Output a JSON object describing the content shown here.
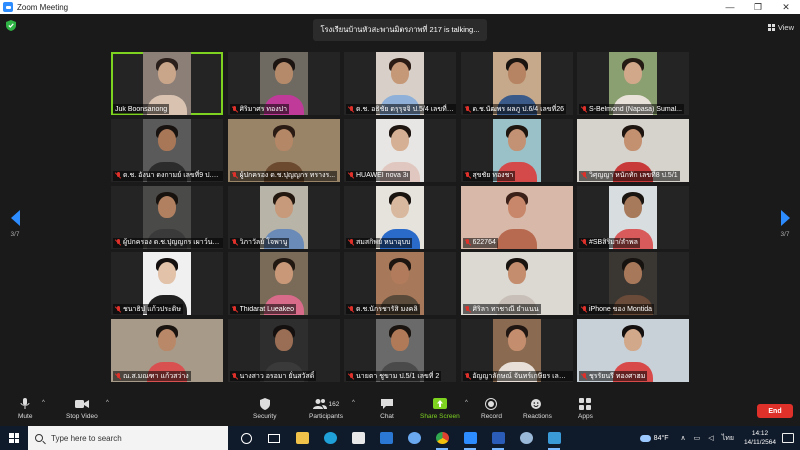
{
  "window": {
    "title": "Zoom Meeting",
    "controls": [
      "—",
      "❐",
      "✕"
    ]
  },
  "meeting": {
    "talking_banner": "โรงเรียนบ้านหัวสะพานมิตรภาพที่ 217 is talking...",
    "view_label": "View",
    "page_indicator": "3/7"
  },
  "participants": [
    {
      "name": "Juk Boonsanong",
      "muted": false,
      "skin": "#c9a58a",
      "hair": "#2a1f1a",
      "body": "#d9c2b0",
      "bg": "#8b7f78",
      "wide": false
    },
    {
      "name": "ศิริมาศร ทองปา",
      "muted": true,
      "skin": "#b58a6a",
      "hair": "#1c1410",
      "body": "#c03a9a",
      "bg": "#6e6a62",
      "wide": false
    },
    {
      "name": "ด.ช. อธิชัย ดรุรุจจิ ป.5/4 เลขที่15",
      "muted": true,
      "skin": "#c59878",
      "hair": "#2a1c14",
      "body": "#8fb0d8",
      "bg": "#d8d0c8",
      "wide": false
    },
    {
      "name": "ด.ช.นัฒพร ผลภู ป.6/4 เลขที่26",
      "muted": true,
      "skin": "#b78463",
      "hair": "#1a1410",
      "body": "#3a5a8a",
      "bg": "#c6a98a",
      "wide": false
    },
    {
      "name": "S-Belmond (Napasa) Sumal...",
      "muted": true,
      "skin": "#d1a88a",
      "hair": "#241a14",
      "body": "#e8e2da",
      "bg": "#8aa070",
      "wide": false
    },
    {
      "name": "ด.ช. อังนา ดงกามย์ เลขที่9 ป.6/1",
      "muted": true,
      "skin": "#a87758",
      "hair": "#181210",
      "body": "#2c2c2c",
      "bg": "#5a5a5a",
      "wide": false
    },
    {
      "name": "ผู้ปกครอง ด.ช.ปุญญกร ทรางร...",
      "muted": true,
      "skin": "#b48767",
      "hair": "#2a1c14",
      "body": "#6b4a30",
      "bg": "#9a8468",
      "wide": true
    },
    {
      "name": "HUAWEI nova 3i",
      "muted": true,
      "skin": "#d6b094",
      "hair": "#1e1510",
      "body": "#e0c8c0",
      "bg": "#e8e6e4",
      "wide": false
    },
    {
      "name": "สุขชัย ทองชา",
      "muted": true,
      "skin": "#c39274",
      "hair": "#201610",
      "body": "#d44a4a",
      "bg": "#9ac0c8",
      "wide": false
    },
    {
      "name": "วิศุญญา หนักทัก เลขที่8 ป.5/1",
      "muted": true,
      "skin": "#c39070",
      "hair": "#1e1510",
      "body": "#c83a3a",
      "bg": "#d6d2cc",
      "wide": true
    },
    {
      "name": "ผู้ปกครอง ด.ช.ปุญญกร เผาว์นาน",
      "muted": true,
      "skin": "#b08060",
      "hair": "#18120e",
      "body": "#3a3a3a",
      "bg": "#4a4a48",
      "wide": false
    },
    {
      "name": "วิภาวัลย์ โจพานู",
      "muted": true,
      "skin": "#c69a7a",
      "hair": "#221810",
      "body": "#6a8ab8",
      "bg": "#b8b4a8",
      "wide": false
    },
    {
      "name": "สมสกิพย์ หนาอุบบ",
      "muted": true,
      "skin": "#d8b89e",
      "hair": "#1a1410",
      "body": "#2a6ac8",
      "bg": "#e6e2dc",
      "wide": false
    },
    {
      "name": "622764",
      "muted": true,
      "skin": "#c8876a",
      "hair": "#3a2018",
      "body": "#b86a50",
      "bg": "#d8b8a8",
      "wide": true
    },
    {
      "name": "#SBสิริมา/ลำพล",
      "muted": true,
      "skin": "#a87a5c",
      "hair": "#1a1410",
      "body": "#d85a5a",
      "bg": "#d8dee0",
      "wide": false
    },
    {
      "name": "ชนาธิป แก้วประดิษ",
      "muted": true,
      "skin": "#e2c2a8",
      "hair": "#141010",
      "body": "#202020",
      "bg": "#f0f0f0",
      "wide": false
    },
    {
      "name": "Thidarat Lueakeo",
      "muted": true,
      "skin": "#c89878",
      "hair": "#221812",
      "body": "#d86a8a",
      "bg": "#7a6a58",
      "wide": false
    },
    {
      "name": "ด.ช.นักรชารัสิ มงคลิ",
      "muted": true,
      "skin": "#b27c5c",
      "hair": "#1e1410",
      "body": "#5a4a3a",
      "bg": "#a8785a",
      "wide": false
    },
    {
      "name": "ศิริลา ทาชาณี ยำแนน",
      "muted": true,
      "skin": "#c48e6e",
      "hair": "#1a1410",
      "body": "#c8c0b8",
      "bg": "#dcd8d2",
      "wide": true
    },
    {
      "name": "iPhone ของ Montida",
      "muted": true,
      "skin": "#a8785a",
      "hair": "#161210",
      "body": "#6a4a38",
      "bg": "#3a3632",
      "wide": false
    },
    {
      "name": "ณ.ส.มณฑา แก้วสว่าง",
      "muted": true,
      "skin": "#b88868",
      "hair": "#1a1410",
      "body": "#d85050",
      "bg": "#a89a88",
      "wide": true
    },
    {
      "name": "นางสาว อรอมา ยั่นสวัสดิ์",
      "muted": true,
      "skin": "#9a6e54",
      "hair": "#141010",
      "body": "#3a3a3a",
      "bg": "#2e2e2e",
      "wide": false
    },
    {
      "name": "นายตา ชูขาม ป.5/1 เลขที่ 2",
      "muted": true,
      "skin": "#b07a58",
      "hair": "#1a1410",
      "body": "#4a4a4a",
      "bg": "#6a6a6a",
      "wide": false
    },
    {
      "name": "อัญญาลักษณ์ จันทร์เกษียร เลขที่28",
      "muted": true,
      "skin": "#c48e6e",
      "hair": "#201612",
      "body": "#e8e0d8",
      "bg": "#8a6a50",
      "wide": false
    },
    {
      "name": "ชุรรัยนรี ทองศาฮม",
      "muted": true,
      "skin": "#d2a88a",
      "hair": "#141010",
      "body": "#d84a4a",
      "bg": "#c8d0d8",
      "wide": true
    }
  ],
  "toolbar": {
    "mute": "Mute",
    "stop_video": "Stop Video",
    "security": "Security",
    "participants": "Participants",
    "participants_count": "162",
    "chat": "Chat",
    "share_screen": "Share Screen",
    "record": "Record",
    "reactions": "Reactions",
    "apps": "Apps",
    "end": "End"
  },
  "taskbar": {
    "search_placeholder": "Type here to search",
    "weather": "84°F",
    "language": "ไทย",
    "time": "14:12",
    "date": "14/11/2564"
  },
  "colors": {
    "accent": "#2d8cff",
    "share_green": "#7ed321",
    "end_red": "#e0302a",
    "muted_red": "#e0302a"
  }
}
